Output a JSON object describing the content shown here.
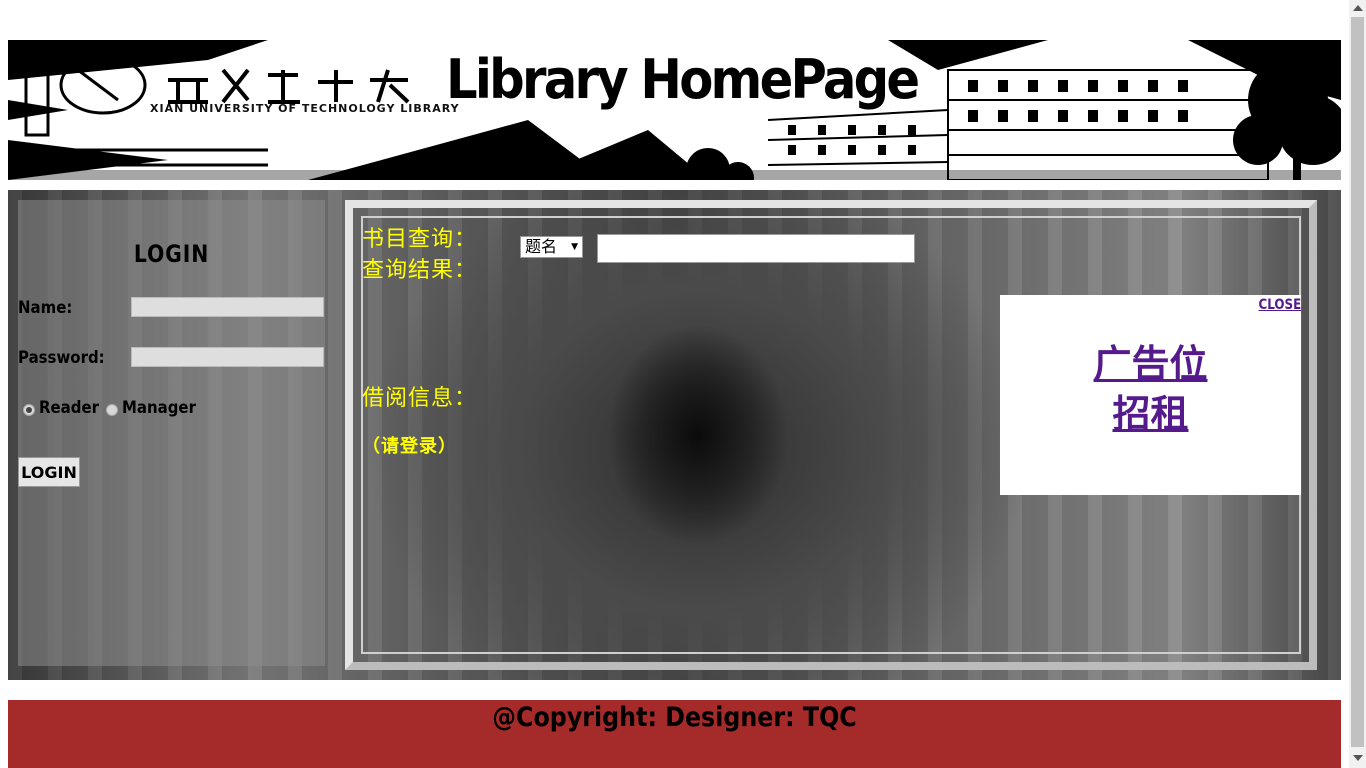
{
  "header": {
    "title": "Library HomePage",
    "logo_text": "XIAN UNIVERSITY OF TECHNOLOGY LIBRARY"
  },
  "login": {
    "title": "LOGIN",
    "name_label": "Name:",
    "password_label": "Password:",
    "name_value": "",
    "password_value": "",
    "role_options": [
      "Reader",
      "Manager"
    ],
    "selected_role": "Reader",
    "button_label": "LOGIN"
  },
  "search": {
    "label": "书目查询：",
    "field_selected": "题名",
    "input_value": "",
    "results_label": "查询结果：",
    "borrow_label": "借阅信息：",
    "login_prompt": "（请登录）"
  },
  "ad": {
    "close_label": "CLOSE",
    "line1": "广告位",
    "line2": "招租"
  },
  "footer": {
    "text": "@Copyright: Designer: TQC"
  },
  "colors": {
    "footer_bg": "#a52a2a",
    "label_yellow": "#ffff00",
    "link_purple": "#551a8b"
  }
}
